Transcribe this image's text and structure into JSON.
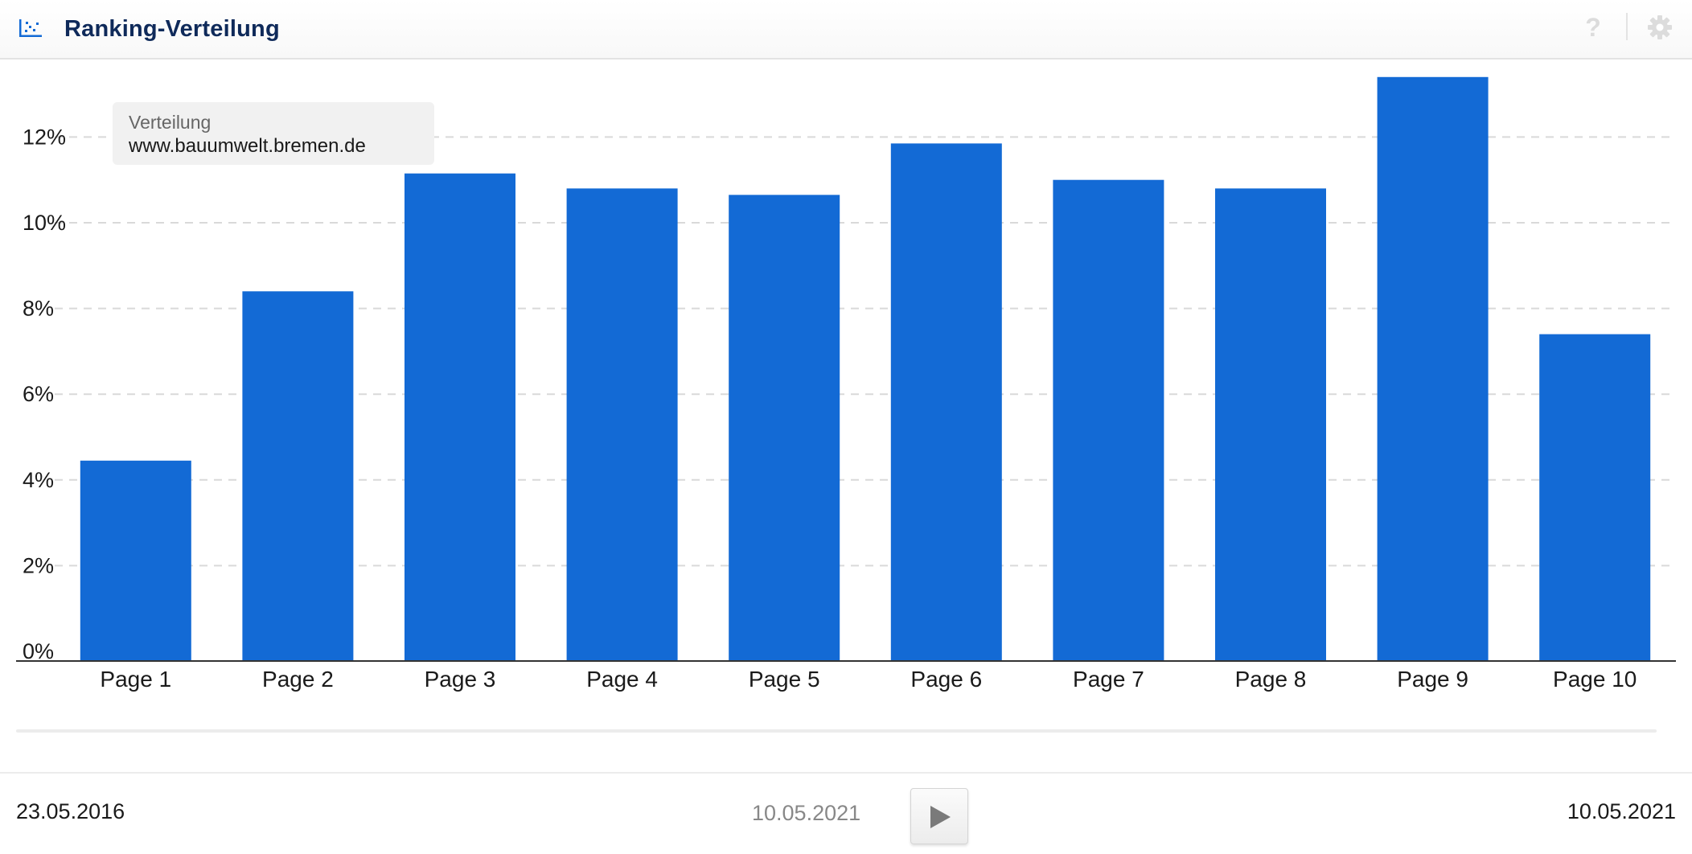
{
  "header": {
    "title": "Ranking-Verteilung",
    "chart_icon": "scatter-chart-icon",
    "help_icon": "question-mark-icon",
    "help_label": "?",
    "settings_icon": "gear-icon"
  },
  "tooltip": {
    "label": "Verteilung",
    "domain": "www.bauumwelt.bremen.de"
  },
  "chart_data": {
    "type": "bar",
    "categories": [
      "Page 1",
      "Page 2",
      "Page 3",
      "Page 4",
      "Page 5",
      "Page 6",
      "Page 7",
      "Page 8",
      "Page 9",
      "Page 10"
    ],
    "series": [
      {
        "values": [
          4.45,
          8.4,
          11.15,
          10.8,
          10.65,
          11.85,
          11.0,
          10.8,
          13.4,
          7.4
        ],
        "color": "#136ad5"
      }
    ],
    "ylim": [
      0,
      13.5
    ],
    "yticks": [
      0,
      2,
      4,
      6,
      8,
      10,
      12
    ],
    "ytick_labels": [
      "0%",
      "2%",
      "4%",
      "6%",
      "8%",
      "10%",
      "12%"
    ],
    "grid": true,
    "grid_style": "dashed",
    "legend": "none"
  },
  "footer": {
    "start_date": "23.05.2016",
    "current_date": "10.05.2021",
    "end_date": "10.05.2021",
    "play_icon": "play-icon"
  },
  "colors": {
    "bar": "#136ad5",
    "title": "#0f2a5a",
    "gridline": "#d9d9d9",
    "axis": "#333333"
  }
}
